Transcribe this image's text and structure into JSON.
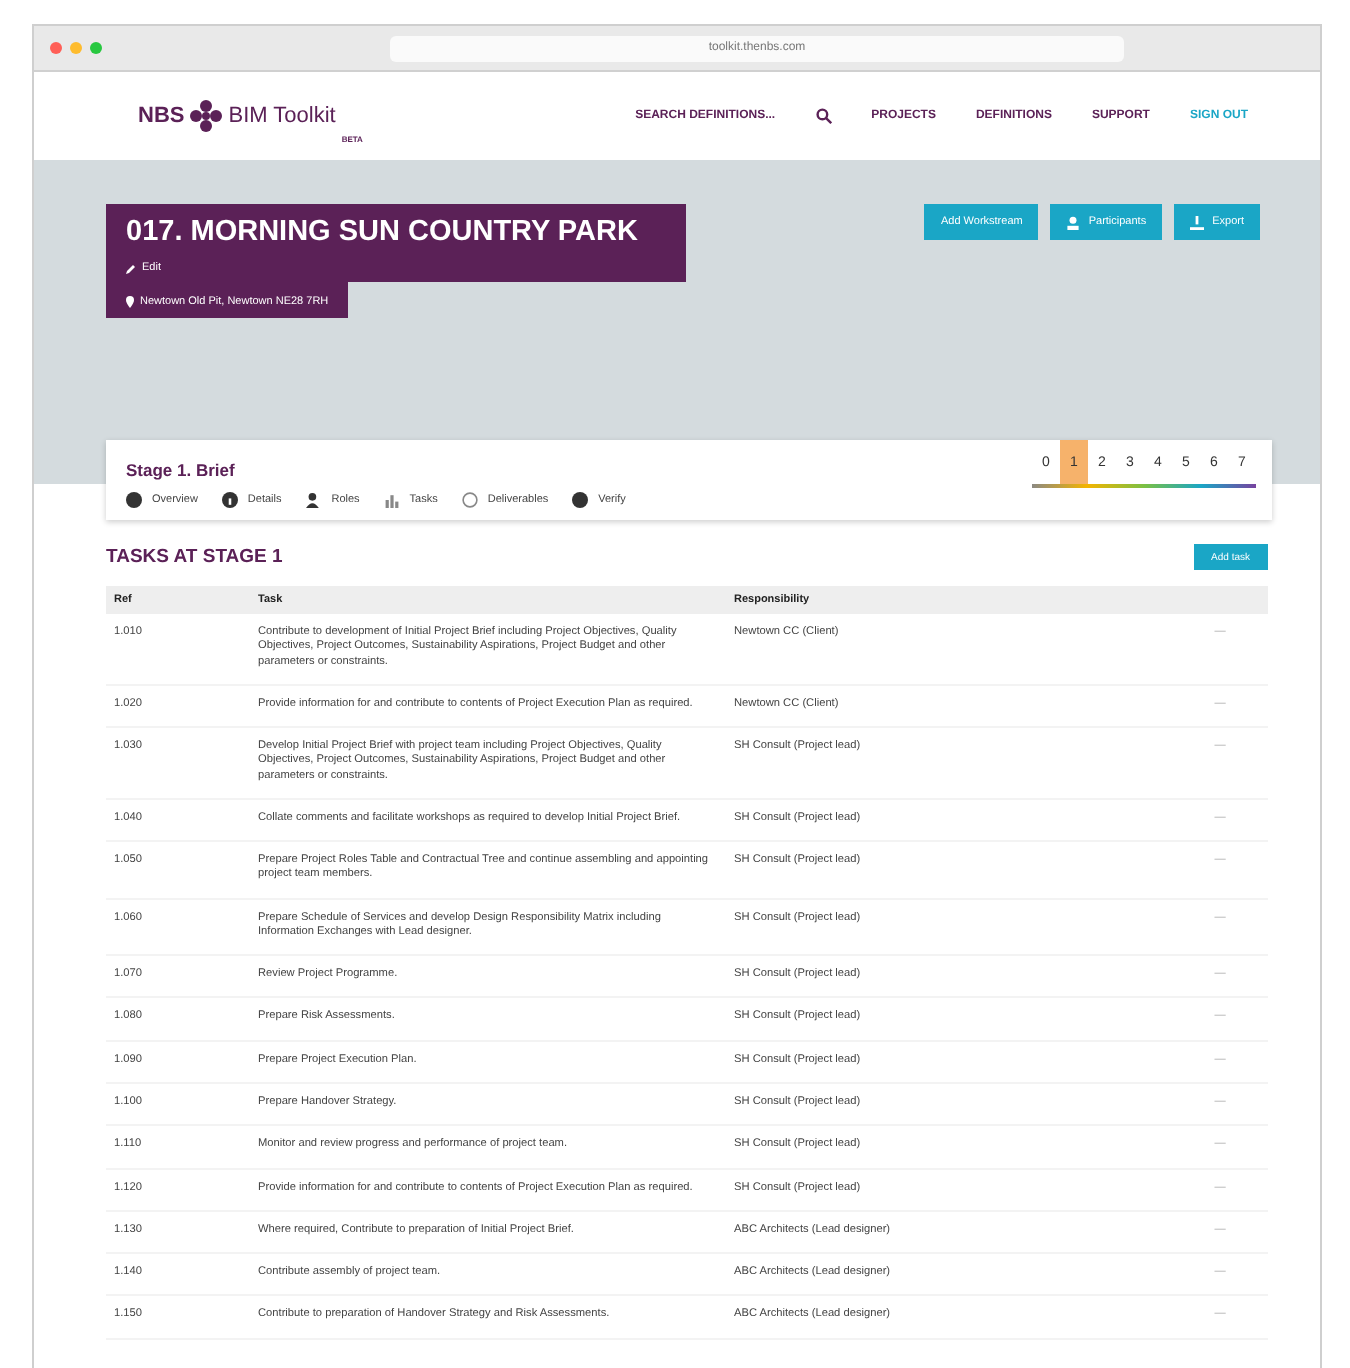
{
  "browser": {
    "url": "toolkit.thenbs.com"
  },
  "header": {
    "logo_left": "NBS",
    "logo_right": "BIM Toolkit",
    "logo_sub": "BETA",
    "search": "SEARCH DEFINITIONS...",
    "nav": [
      "PROJECTS",
      "DEFINITIONS",
      "SUPPORT"
    ],
    "signout": "SIGN OUT"
  },
  "project": {
    "title": "017. MORNING SUN COUNTRY PARK",
    "edit": "Edit",
    "address": "Newtown Old Pit, Newtown NE28 7RH"
  },
  "actions": [
    {
      "kind": "text",
      "label": "Add Workstream"
    },
    {
      "kind": "people",
      "label": "Participants"
    },
    {
      "kind": "export",
      "label": "Export"
    }
  ],
  "stage": {
    "title": "Stage 1. Brief",
    "steps": [
      {
        "label": "0",
        "selected": false
      },
      {
        "label": "1",
        "selected": true
      },
      {
        "label": "2",
        "selected": false
      },
      {
        "label": "3",
        "selected": false
      },
      {
        "label": "4",
        "selected": false
      },
      {
        "label": "5",
        "selected": false
      },
      {
        "label": "6",
        "selected": false
      },
      {
        "label": "7",
        "selected": false
      }
    ],
    "tabs": [
      {
        "kind": "overview",
        "label": "Overview"
      },
      {
        "kind": "details",
        "label": "Details"
      },
      {
        "kind": "roles",
        "label": "Roles"
      },
      {
        "kind": "tasks",
        "label": "Tasks"
      },
      {
        "kind": "deliverables",
        "label": "Deliverables"
      },
      {
        "kind": "verify",
        "label": "Verify"
      }
    ]
  },
  "tasks": {
    "heading": "TASKS AT STAGE 1",
    "add": "Add task",
    "columns": [
      "Ref",
      "Task",
      "Responsibility"
    ],
    "rows": [
      {
        "ref": "1.010",
        "task": "Contribute to development of Initial Project Brief including Project Objectives, Quality Objectives, Project Outcomes, Sustainability Aspirations, Project Budget and other parameters or constraints.",
        "resp": "Newtown CC (Client)",
        "action": "—"
      },
      {
        "ref": "1.020",
        "task": "Provide information for and contribute to contents of Project Execution Plan as required.",
        "resp": "Newtown CC (Client)",
        "action": "—"
      },
      {
        "ref": "1.030",
        "task": "Develop Initial Project Brief with project team including Project Objectives, Quality Objectives, Project Outcomes, Sustainability Aspirations, Project Budget and other parameters or constraints.",
        "resp": "SH Consult (Project lead)",
        "action": "—"
      },
      {
        "ref": "1.040",
        "task": "Collate comments and facilitate workshops as required to develop Initial Project Brief.",
        "resp": "SH Consult (Project lead)",
        "action": "—"
      },
      {
        "ref": "1.050",
        "task": "Prepare Project Roles Table and Contractual Tree and continue assembling and appointing project team members.",
        "resp": "SH Consult (Project lead)",
        "action": "—"
      },
      {
        "ref": "1.060",
        "task": "Prepare Schedule of Services and develop Design Responsibility Matrix including Information Exchanges with Lead designer.",
        "resp": "SH Consult (Project lead)",
        "action": "—"
      },
      {
        "ref": "1.070",
        "task": "Review Project Programme.",
        "resp": "SH Consult (Project lead)",
        "action": "—"
      },
      {
        "ref": "1.080",
        "task": "Prepare Risk Assessments.",
        "resp": "SH Consult (Project lead)",
        "action": "—"
      },
      {
        "ref": "1.090",
        "task": "Prepare Project Execution Plan.",
        "resp": "SH Consult (Project lead)",
        "action": "—"
      },
      {
        "ref": "1.100",
        "task": "Prepare Handover Strategy.",
        "resp": "SH Consult (Project lead)",
        "action": "—"
      },
      {
        "ref": "1.110",
        "task": "Monitor and review progress and performance of project team.",
        "resp": "SH Consult (Project lead)",
        "action": "—"
      },
      {
        "ref": "1.120",
        "task": "Provide information for and contribute to contents of Project Execution Plan as required.",
        "resp": "SH Consult (Project lead)",
        "action": "—"
      },
      {
        "ref": "1.130",
        "task": "Where required, Contribute to preparation of Initial Project Brief.",
        "resp": "ABC Architects (Lead designer)",
        "action": "—"
      },
      {
        "ref": "1.140",
        "task": "Contribute assembly of project team.",
        "resp": "ABC Architects (Lead designer)",
        "action": "—"
      },
      {
        "ref": "1.150",
        "task": "Contribute to preparation of Handover Strategy and Risk Assessments.",
        "resp": "ABC Architects (Lead designer)",
        "action": "—"
      }
    ]
  }
}
